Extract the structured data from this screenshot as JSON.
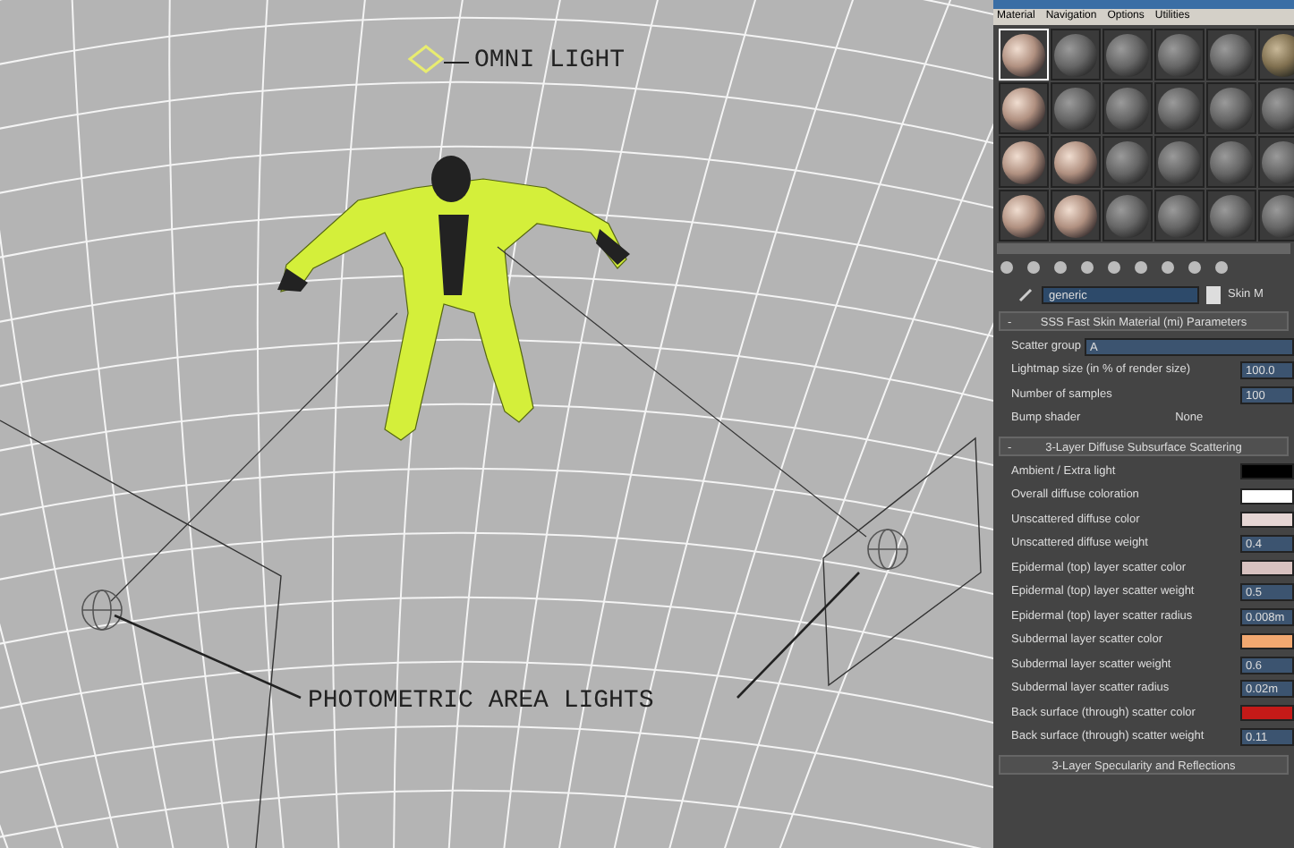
{
  "viewport": {
    "labels": [
      {
        "kind": "omni",
        "text": "OMNI LIGHT"
      },
      {
        "kind": "area",
        "text": "PHOTOMETRIC AREA LIGHTS"
      }
    ]
  },
  "material_editor": {
    "menu": [
      "Material",
      "Navigation",
      "Options",
      "Utilities"
    ],
    "slots": [
      {
        "kind": "skin",
        "selected": true
      },
      {
        "kind": "grey",
        "selected": false
      },
      {
        "kind": "grey",
        "selected": false
      },
      {
        "kind": "grey",
        "selected": false
      },
      {
        "kind": "grey",
        "selected": false
      },
      {
        "kind": "tan",
        "selected": false
      },
      {
        "kind": "skin",
        "selected": false
      },
      {
        "kind": "grey",
        "selected": false
      },
      {
        "kind": "grey",
        "selected": false
      },
      {
        "kind": "grey",
        "selected": false
      },
      {
        "kind": "grey",
        "selected": false
      },
      {
        "kind": "grey",
        "selected": false
      },
      {
        "kind": "skin",
        "selected": false
      },
      {
        "kind": "skin",
        "selected": false
      },
      {
        "kind": "grey",
        "selected": false
      },
      {
        "kind": "grey",
        "selected": false
      },
      {
        "kind": "grey",
        "selected": false
      },
      {
        "kind": "grey",
        "selected": false
      },
      {
        "kind": "skin",
        "selected": false
      },
      {
        "kind": "skin",
        "selected": false
      },
      {
        "kind": "grey",
        "selected": false
      },
      {
        "kind": "grey",
        "selected": false
      },
      {
        "kind": "grey",
        "selected": false
      },
      {
        "kind": "grey",
        "selected": false
      }
    ],
    "material_name": "generic",
    "material_type": "Skin M",
    "rollouts": [
      {
        "toggle": "-",
        "title": "SSS Fast Skin Material (mi) Parameters",
        "params": [
          {
            "kind": "text",
            "label": "Scatter group",
            "value": "A"
          },
          {
            "kind": "number",
            "label": "Lightmap size (in % of render size)",
            "value": "100.0"
          },
          {
            "kind": "number",
            "label": "Number of samples",
            "value": "100"
          },
          {
            "kind": "button",
            "label": "Bump shader",
            "value": "None"
          }
        ]
      },
      {
        "toggle": "-",
        "title": "3-Layer Diffuse Subsurface Scattering",
        "params": [
          {
            "kind": "color",
            "label": "Ambient / Extra light",
            "color": "#000000"
          },
          {
            "kind": "color",
            "label": "Overall diffuse coloration",
            "color": "#ffffff"
          },
          {
            "kind": "color",
            "label": "Unscattered diffuse color",
            "color": "#e6d6d4"
          },
          {
            "kind": "number",
            "label": "Unscattered diffuse weight",
            "value": "0.4"
          },
          {
            "kind": "color",
            "label": "Epidermal (top) layer scatter color",
            "color": "#d8c2c0"
          },
          {
            "kind": "number",
            "label": "Epidermal (top) layer scatter weight",
            "value": "0.5"
          },
          {
            "kind": "number",
            "label": "Epidermal (top) layer scatter radius",
            "value": "0.008m"
          },
          {
            "kind": "color",
            "label": "Subdermal layer scatter color",
            "color": "#f2a870"
          },
          {
            "kind": "number",
            "label": "Subdermal layer scatter weight",
            "value": "0.6"
          },
          {
            "kind": "number",
            "label": "Subdermal layer scatter radius",
            "value": "0.02m"
          },
          {
            "kind": "color",
            "label": "Back surface (through) scatter color",
            "color": "#c41a18"
          },
          {
            "kind": "number",
            "label": "Back surface (through) scatter weight",
            "value": "0.11"
          }
        ]
      },
      {
        "title": "3-Layer Specularity and Reflections"
      }
    ]
  }
}
